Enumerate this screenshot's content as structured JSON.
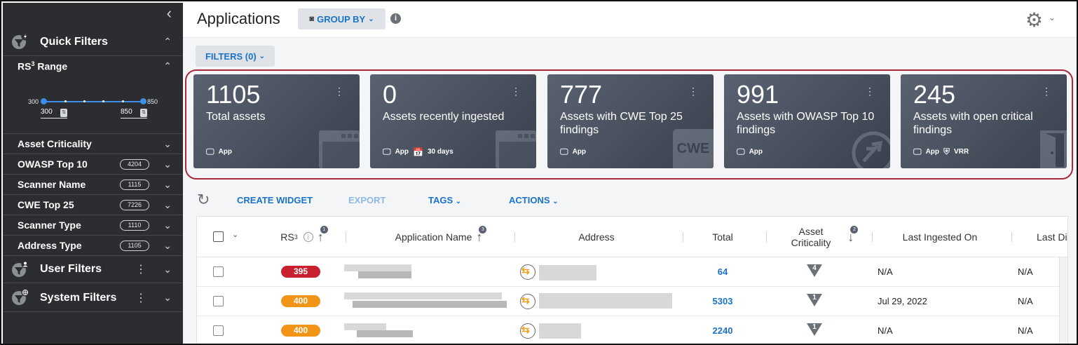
{
  "sidebar": {
    "quick_filters": "Quick Filters",
    "rs_range": "Range",
    "rs_prefix": "RS",
    "rs_sup": "3",
    "range_min": "300",
    "range_max": "850",
    "input_min": "300",
    "input_max": "850",
    "items": [
      {
        "label": "Asset Criticality",
        "count": ""
      },
      {
        "label": "OWASP Top 10",
        "count": "4204"
      },
      {
        "label": "Scanner Name",
        "count": "1115"
      },
      {
        "label": "CWE Top 25",
        "count": "7226"
      },
      {
        "label": "Scanner Type",
        "count": "1110"
      },
      {
        "label": "Address Type",
        "count": "1105"
      }
    ],
    "user_filters": "User Filters",
    "system_filters": "System Filters"
  },
  "header": {
    "title": "Applications",
    "group_by": "GROUP BY",
    "info": "i"
  },
  "filters_button": "FILTERS (0)",
  "cards": [
    {
      "value": "1105",
      "label": "Total assets",
      "tag1": "App",
      "tag2": ""
    },
    {
      "value": "0",
      "label": "Assets recently ingested",
      "tag1": "App",
      "tag2": "30 days"
    },
    {
      "value": "777",
      "label": "Assets with CWE Top 25 findings",
      "tag1": "App",
      "tag2": "",
      "bg_text": "CWE"
    },
    {
      "value": "991",
      "label": "Assets with OWASP Top 10 findings",
      "tag1": "App",
      "tag2": ""
    },
    {
      "value": "245",
      "label": "Assets with open critical findings",
      "tag1": "App",
      "tag2": "VRR"
    }
  ],
  "toolbar": {
    "create_widget": "CREATE WIDGET",
    "export": "EXPORT",
    "tags": "TAGS",
    "actions": "ACTIONS"
  },
  "table": {
    "columns": {
      "rs": "RS",
      "rs_sup": "3",
      "rs_sort": "1",
      "app_name": "Application Name",
      "app_sort": "3",
      "address": "Address",
      "total": "Total",
      "criticality_line1": "Asset",
      "criticality_line2": "Criticality",
      "crit_sort": "2",
      "last_ingested": "Last Ingested On",
      "last_di": "Last Di"
    },
    "rows": [
      {
        "rs": "395",
        "rs_color": "#c8202e",
        "total": "64",
        "criticality": "4",
        "last_ingested": "N/A",
        "last_di": "N/A"
      },
      {
        "rs": "400",
        "rs_color": "#f29418",
        "total": "5303",
        "criticality": "1",
        "last_ingested": "Jul 29, 2022",
        "last_di": "N/A"
      },
      {
        "rs": "400",
        "rs_color": "#f29418",
        "total": "2240",
        "criticality": "1",
        "last_ingested": "N/A",
        "last_di": "N/A"
      }
    ]
  }
}
